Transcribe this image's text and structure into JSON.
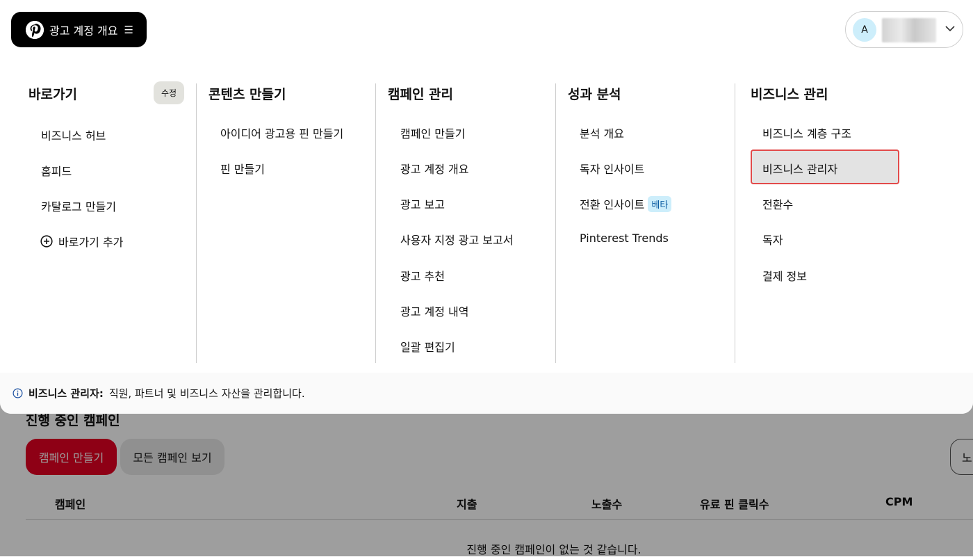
{
  "header": {
    "overview_label": "광고 계정 개요",
    "avatar_initial": "A"
  },
  "columns": [
    {
      "title": "바로가기",
      "edit_label": "수정",
      "items": [
        "비즈니스 허브",
        "홈피드",
        "카탈로그 만들기"
      ],
      "add_label": "바로가기 추가"
    },
    {
      "title": "콘텐츠 만들기",
      "items": [
        "아이디어 광고용 핀 만들기",
        "핀 만들기"
      ]
    },
    {
      "title": "캠페인 관리",
      "items": [
        "캠페인 만들기",
        "광고 계정 개요",
        "광고 보고",
        "사용자 지정 광고 보고서",
        "광고 추천",
        "광고 계정 내역",
        "일괄 편집기"
      ]
    },
    {
      "title": "성과 분석",
      "items": [
        "분석 개요",
        "독자 인사이트",
        "전환 인사이트",
        "Pinterest Trends"
      ],
      "beta_label": "베타"
    },
    {
      "title": "비즈니스 관리",
      "items": [
        "비즈니스 계층 구조",
        "비즈니스 관리자",
        "전환수",
        "독자",
        "결제 정보"
      ]
    }
  ],
  "info_bar": {
    "bold": "비즈니스 관리자:",
    "text": "직원, 파트너 및 비즈니스 자산을 관리합니다."
  },
  "background": {
    "section_title": "진행 중인 캠페인",
    "create_button": "캠페인 만들기",
    "view_all_button": "모든 캠페인 보기",
    "right_button": "노",
    "table_headers": [
      "캠페인",
      "지출",
      "노출수",
      "유료 핀 클릭수",
      "CPM"
    ],
    "empty_message": "진행 중인 캠페인이 없는 것 같습니다."
  },
  "colors": {
    "brand_red": "#e60023",
    "highlight_border": "#e24a4a",
    "beta_bg": "#cdeefb"
  }
}
